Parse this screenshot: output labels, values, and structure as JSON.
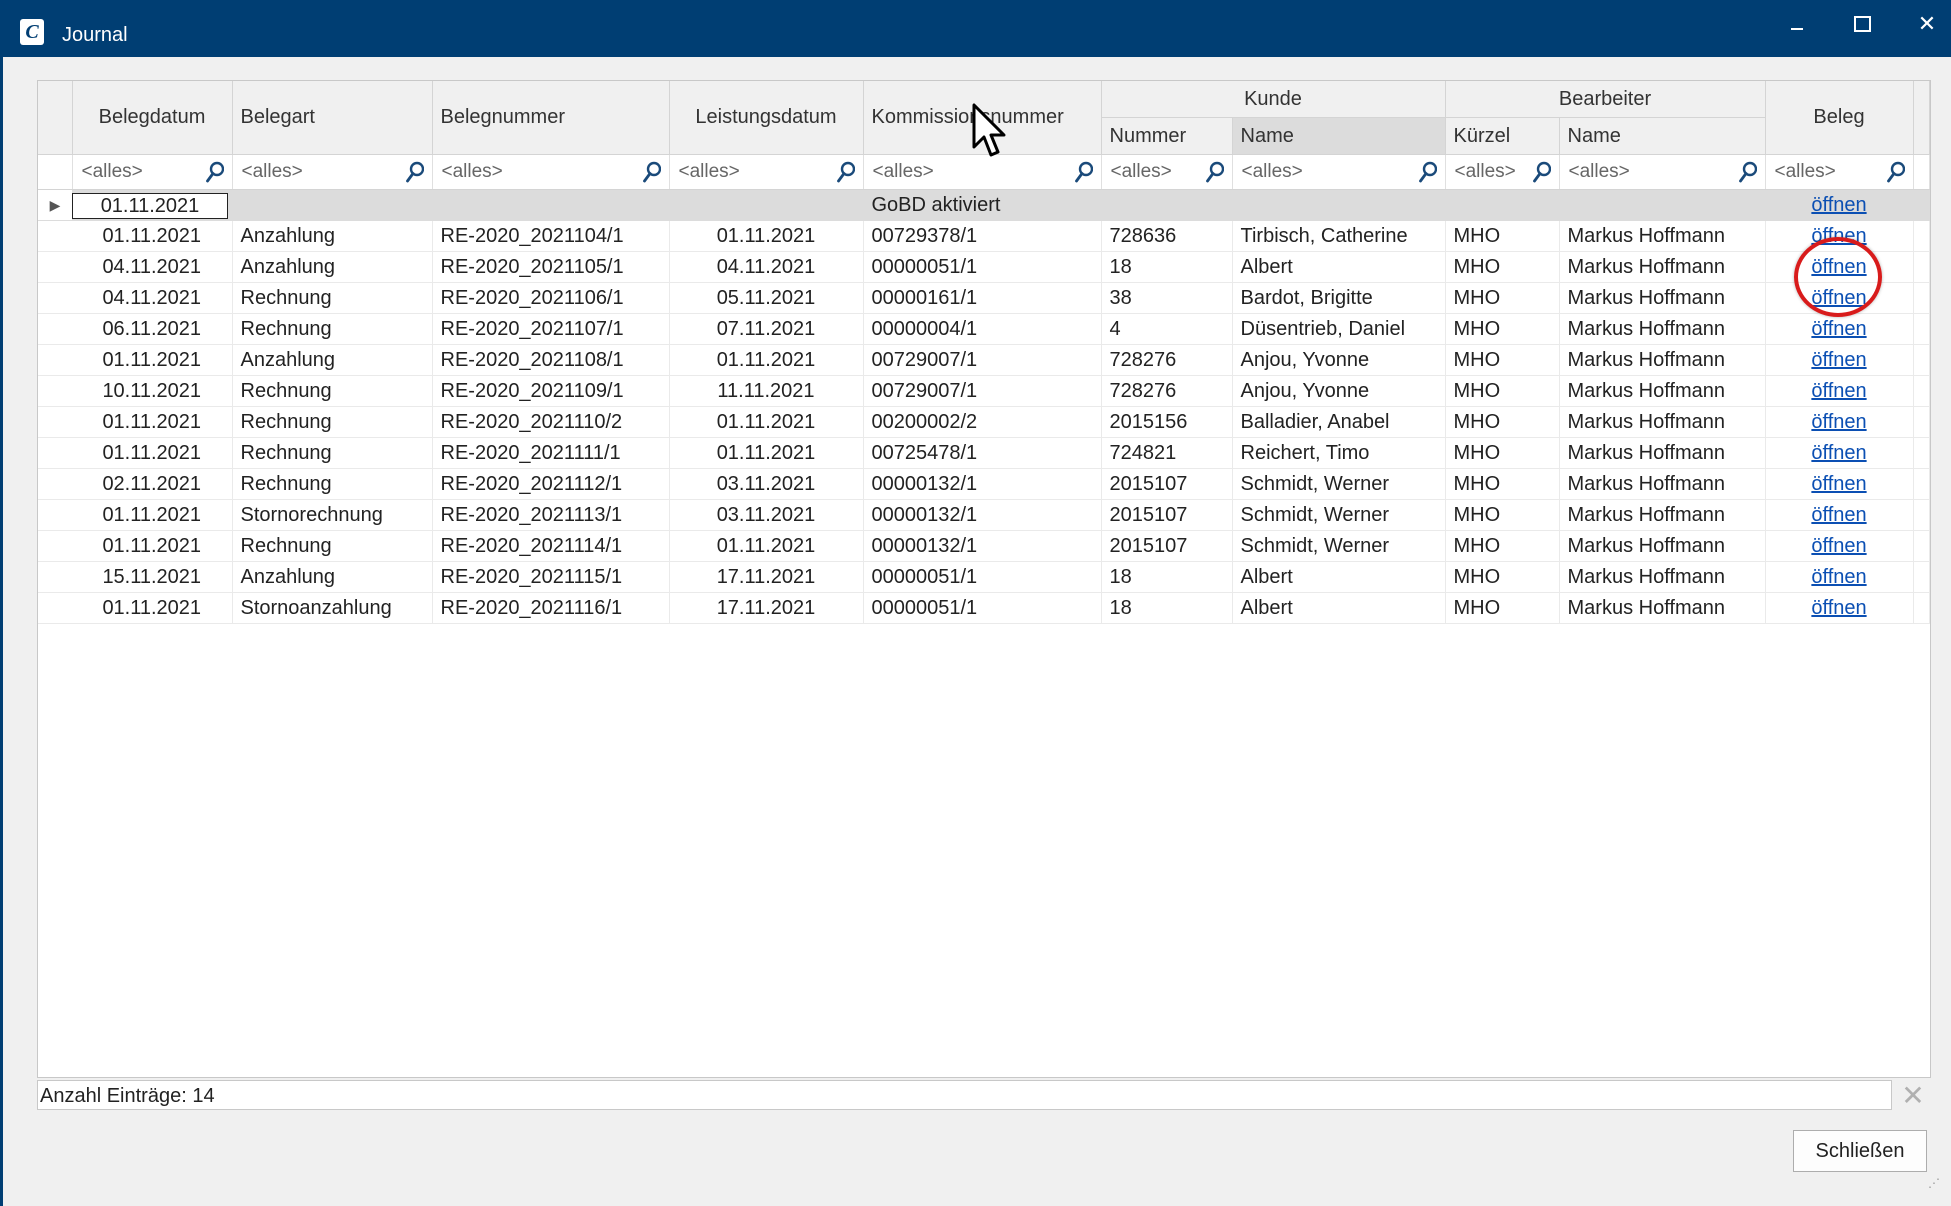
{
  "window": {
    "title": "Journal",
    "app_icon_letter": "C",
    "close_glyph": "✕"
  },
  "columns": {
    "belegdatum": "Belegdatum",
    "belegart": "Belegart",
    "belegnummer": "Belegnummer",
    "leistungsdatum": "Leistungsdatum",
    "kommission": "Kommissionsnummer",
    "kunde_group": "Kunde",
    "kunde_nummer": "Nummer",
    "kunde_name": "Name",
    "bearbeiter_group": "Bearbeiter",
    "bearbeiter_kuerzel": "Kürzel",
    "bearbeiter_name": "Name",
    "beleg": "Beleg"
  },
  "filter_placeholder": "<alles>",
  "group_row": {
    "date": "01.11.2021",
    "label": "GoBD aktiviert",
    "link": "öffnen"
  },
  "rows": [
    {
      "belegdatum": "01.11.2021",
      "belegart": "Anzahlung",
      "belegnummer": "RE-2020_2021104/1",
      "leistungsdatum": "01.11.2021",
      "kommission": "00729378/1",
      "kunde_nummer": "728636",
      "kunde_name": "Tirbisch, Catherine",
      "kuerzel": "MHO",
      "bearbeiter": "Markus Hoffmann",
      "beleg": "öffnen"
    },
    {
      "belegdatum": "04.11.2021",
      "belegart": "Anzahlung",
      "belegnummer": "RE-2020_2021105/1",
      "leistungsdatum": "04.11.2021",
      "kommission": "00000051/1",
      "kunde_nummer": "18",
      "kunde_name": "Albert",
      "kuerzel": "MHO",
      "bearbeiter": "Markus Hoffmann",
      "beleg": "öffnen"
    },
    {
      "belegdatum": "04.11.2021",
      "belegart": "Rechnung",
      "belegnummer": "RE-2020_2021106/1",
      "leistungsdatum": "05.11.2021",
      "kommission": "00000161/1",
      "kunde_nummer": "38",
      "kunde_name": "Bardot, Brigitte",
      "kuerzel": "MHO",
      "bearbeiter": "Markus Hoffmann",
      "beleg": "öffnen"
    },
    {
      "belegdatum": "06.11.2021",
      "belegart": "Rechnung",
      "belegnummer": "RE-2020_2021107/1",
      "leistungsdatum": "07.11.2021",
      "kommission": "00000004/1",
      "kunde_nummer": "4",
      "kunde_name": "Düsentrieb, Daniel",
      "kuerzel": "MHO",
      "bearbeiter": "Markus Hoffmann",
      "beleg": "öffnen"
    },
    {
      "belegdatum": "01.11.2021",
      "belegart": "Anzahlung",
      "belegnummer": "RE-2020_2021108/1",
      "leistungsdatum": "01.11.2021",
      "kommission": "00729007/1",
      "kunde_nummer": "728276",
      "kunde_name": "Anjou, Yvonne",
      "kuerzel": "MHO",
      "bearbeiter": "Markus Hoffmann",
      "beleg": "öffnen"
    },
    {
      "belegdatum": "10.11.2021",
      "belegart": "Rechnung",
      "belegnummer": "RE-2020_2021109/1",
      "leistungsdatum": "11.11.2021",
      "kommission": "00729007/1",
      "kunde_nummer": "728276",
      "kunde_name": "Anjou, Yvonne",
      "kuerzel": "MHO",
      "bearbeiter": "Markus Hoffmann",
      "beleg": "öffnen"
    },
    {
      "belegdatum": "01.11.2021",
      "belegart": "Rechnung",
      "belegnummer": "RE-2020_2021110/2",
      "leistungsdatum": "01.11.2021",
      "kommission": "00200002/2",
      "kunde_nummer": "2015156",
      "kunde_name": "Balladier, Anabel",
      "kuerzel": "MHO",
      "bearbeiter": "Markus Hoffmann",
      "beleg": "öffnen"
    },
    {
      "belegdatum": "01.11.2021",
      "belegart": "Rechnung",
      "belegnummer": "RE-2020_2021111/1",
      "leistungsdatum": "01.11.2021",
      "kommission": "00725478/1",
      "kunde_nummer": "724821",
      "kunde_name": "Reichert, Timo",
      "kuerzel": "MHO",
      "bearbeiter": "Markus Hoffmann",
      "beleg": "öffnen"
    },
    {
      "belegdatum": "02.11.2021",
      "belegart": "Rechnung",
      "belegnummer": "RE-2020_2021112/1",
      "leistungsdatum": "03.11.2021",
      "kommission": "00000132/1",
      "kunde_nummer": "2015107",
      "kunde_name": "Schmidt, Werner",
      "kuerzel": "MHO",
      "bearbeiter": "Markus Hoffmann",
      "beleg": "öffnen"
    },
    {
      "belegdatum": "01.11.2021",
      "belegart": "Stornorechnung",
      "belegnummer": "RE-2020_2021113/1",
      "leistungsdatum": "03.11.2021",
      "kommission": "00000132/1",
      "kunde_nummer": "2015107",
      "kunde_name": "Schmidt, Werner",
      "kuerzel": "MHO",
      "bearbeiter": "Markus Hoffmann",
      "beleg": "öffnen"
    },
    {
      "belegdatum": "01.11.2021",
      "belegart": "Rechnung",
      "belegnummer": "RE-2020_2021114/1",
      "leistungsdatum": "01.11.2021",
      "kommission": "00000132/1",
      "kunde_nummer": "2015107",
      "kunde_name": "Schmidt, Werner",
      "kuerzel": "MHO",
      "bearbeiter": "Markus Hoffmann",
      "beleg": "öffnen"
    },
    {
      "belegdatum": "15.11.2021",
      "belegart": "Anzahlung",
      "belegnummer": "RE-2020_2021115/1",
      "leistungsdatum": "17.11.2021",
      "kommission": "00000051/1",
      "kunde_nummer": "18",
      "kunde_name": "Albert",
      "kuerzel": "MHO",
      "bearbeiter": "Markus Hoffmann",
      "beleg": "öffnen"
    },
    {
      "belegdatum": "01.11.2021",
      "belegart": "Stornoanzahlung",
      "belegnummer": "RE-2020_2021116/1",
      "leistungsdatum": "17.11.2021",
      "kommission": "00000051/1",
      "kunde_nummer": "18",
      "kunde_name": "Albert",
      "kuerzel": "MHO",
      "bearbeiter": "Markus Hoffmann",
      "beleg": "öffnen"
    }
  ],
  "status": {
    "count_text": "Anzahl Einträge: 14"
  },
  "buttons": {
    "close_label": "Schließen"
  },
  "colors": {
    "titlebar": "#003e73",
    "link": "#0b4fb3",
    "highlight": "#d81b1b"
  }
}
